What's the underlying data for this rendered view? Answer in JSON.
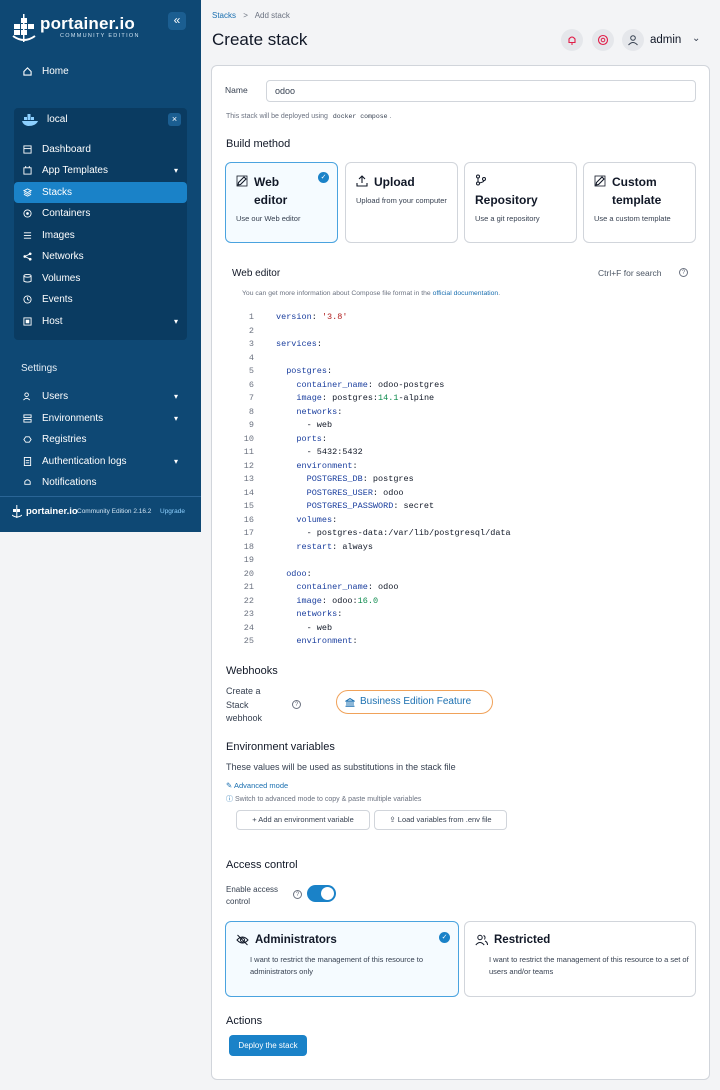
{
  "sidebar": {
    "logo_text": "portainer.io",
    "logo_subtitle": "COMMUNITY EDITION",
    "home": "Home",
    "environment": "local",
    "env_items": [
      {
        "label": "Dashboard"
      },
      {
        "label": "App Templates"
      },
      {
        "label": "Stacks"
      },
      {
        "label": "Containers"
      },
      {
        "label": "Images"
      },
      {
        "label": "Networks"
      },
      {
        "label": "Volumes"
      },
      {
        "label": "Events"
      },
      {
        "label": "Host"
      }
    ],
    "settings_label": "Settings",
    "settings_items": [
      {
        "label": "Users"
      },
      {
        "label": "Environments"
      },
      {
        "label": "Registries"
      },
      {
        "label": "Authentication logs"
      },
      {
        "label": "Notifications"
      }
    ],
    "footer": {
      "logo": "portainer.io",
      "edition": "Community Edition  2.16.2",
      "upgrade": "Upgrade"
    }
  },
  "header": {
    "breadcrumb_root": "Stacks",
    "breadcrumb_sep": ">",
    "breadcrumb_current": "Add stack",
    "title": "Create stack",
    "user": "admin"
  },
  "form": {
    "name_label": "Name",
    "name_value": "odoo",
    "deploy_hint_pre": "This stack will be deployed using",
    "deploy_hint_code": "docker compose",
    "deploy_hint_post": ".",
    "build_method_title": "Build method",
    "build_methods": [
      {
        "title": "Web editor",
        "desc": "Use our Web editor",
        "selected": true
      },
      {
        "title": "Upload",
        "desc": "Upload from your computer"
      },
      {
        "title": "Repository",
        "desc": "Use a git repository"
      },
      {
        "title": "Custom template",
        "desc": "Use a custom template"
      }
    ],
    "editor_title": "Web editor",
    "editor_search_hint": "Ctrl+F for search",
    "editor_info_pre": "You can get more information about Compose file format in the",
    "editor_info_link": "official documentation",
    "editor_info_post": ".",
    "code_lines": [
      "version: '3.8'",
      "",
      "services:",
      "",
      "  postgres:",
      "    container_name: odoo-postgres",
      "    image: postgres:14.1-alpine",
      "    networks:",
      "      - web",
      "    ports:",
      "      - 5432:5432",
      "    environment:",
      "      POSTGRES_DB: postgres",
      "      POSTGRES_USER: odoo",
      "      POSTGRES_PASSWORD: secret",
      "    volumes:",
      "      - postgres-data:/var/lib/postgresql/data",
      "    restart: always",
      "",
      "  odoo:",
      "    container_name: odoo",
      "    image: odoo:16.0",
      "    networks:",
      "      - web",
      "    environment:"
    ],
    "webhooks_title": "Webhooks",
    "webhook_label": "Create a Stack webhook",
    "business_feature": "Business Edition Feature",
    "env_vars_title": "Environment variables",
    "env_vars_desc": "These values will be used as substitutions in the stack file",
    "advanced_mode": "Advanced mode",
    "advanced_hint": "Switch to advanced mode to copy & paste multiple variables",
    "add_env_var": "Add an environment variable",
    "load_env_file": "Load variables from .env file",
    "access_title": "Access control",
    "enable_access_label": "Enable access control",
    "access_enabled": true,
    "access_options": [
      {
        "title": "Administrators",
        "desc": "I want to restrict the management of this resource to administrators only",
        "selected": true
      },
      {
        "title": "Restricted",
        "desc": "I want to restrict the management of this resource to a set of users and/or teams"
      }
    ],
    "actions_title": "Actions",
    "deploy_button": "Deploy the stack"
  },
  "colors": {
    "sidebar_bg": "#0e4874",
    "accent": "#1a82c8",
    "feature_border": "#f0a25a"
  }
}
